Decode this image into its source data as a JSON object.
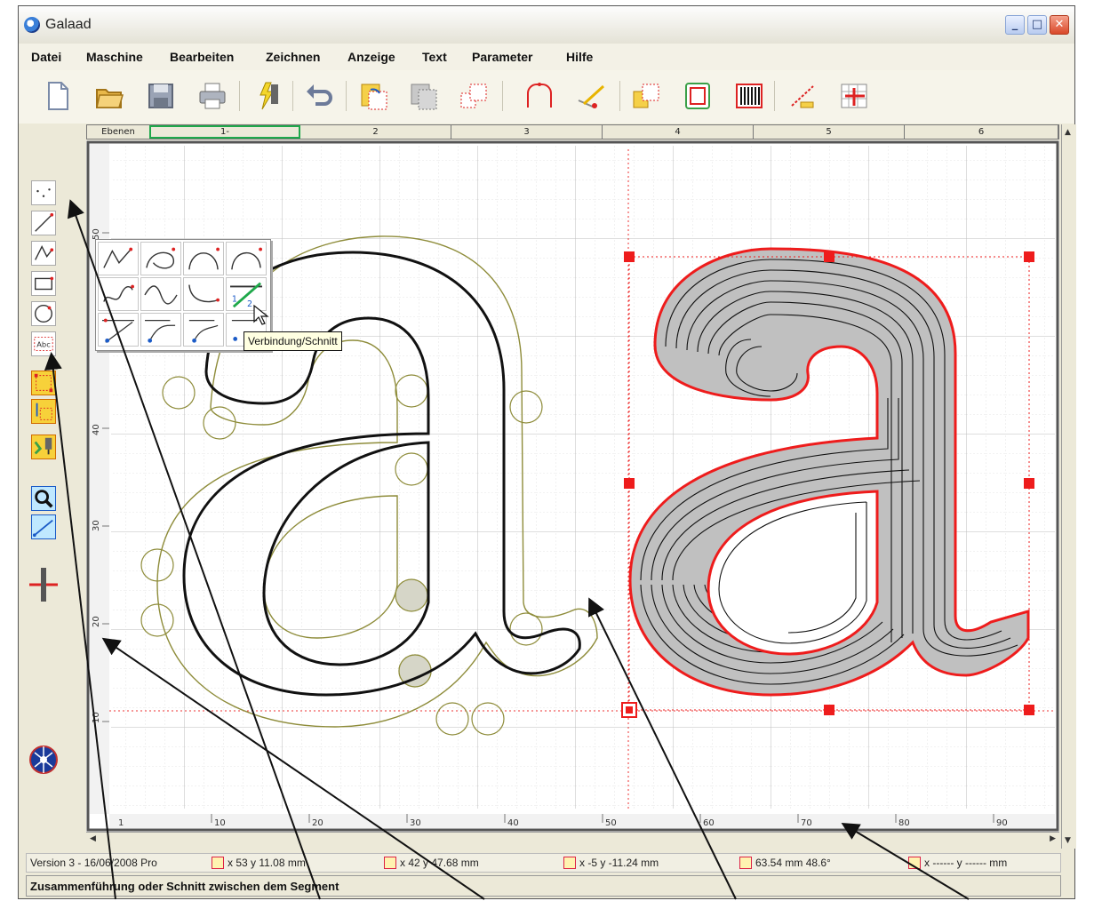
{
  "window": {
    "title": "Galaad"
  },
  "menu": [
    "Datei",
    "Maschine",
    "Bearbeiten",
    "Zeichnen",
    "Anzeige",
    "Text",
    "Parameter",
    "Hilfe"
  ],
  "layers": {
    "label": "Ebenen",
    "tabs": [
      "1-",
      "2",
      "3",
      "4",
      "5",
      "6"
    ]
  },
  "ruler": {
    "x_labels": [
      "10",
      "20",
      "30",
      "40",
      "50",
      "60",
      "70",
      "80",
      "90"
    ],
    "y_labels": [
      "50",
      "40",
      "30",
      "20",
      "10"
    ],
    "origin": "1"
  },
  "tooltip": "Verbindung/Schnitt",
  "status": {
    "version": "Version 3 - 16/06/2008 Pro",
    "pos1": "x 53   y 11.08  mm",
    "pos2": "x 42   y 47.68  mm",
    "pos3": "x -5   y -11.24  mm",
    "dist": "63.54 mm   48.6°",
    "pos4": "x ------   y ------  mm"
  },
  "hint": "Zusammenführung oder Schnitt zwischen dem Segment",
  "colors": {
    "selection": "#ff0000",
    "outline": "#8a8a3a",
    "glyph": "#111111",
    "grid": "#c9c9c9"
  }
}
